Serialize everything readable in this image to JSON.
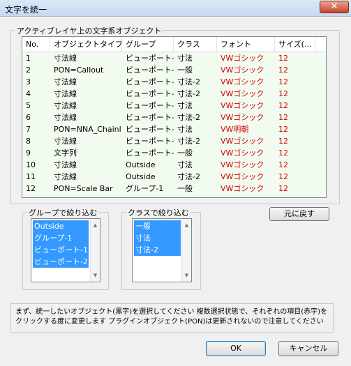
{
  "window": {
    "title": "文字を統一",
    "close_symbol": "✕"
  },
  "objects_group": {
    "legend": "アクティブレイヤ上の文字系オブジェクト",
    "columns": [
      "No.",
      "オブジェクトタイプ",
      "グループ",
      "クラス",
      "フォント",
      "サイズ(..."
    ],
    "rows": [
      [
        "1",
        "寸法線",
        "ビューポート-2",
        "寸法",
        "VWゴシック",
        "12"
      ],
      [
        "2",
        "PON=Callout",
        "ビューポート-1",
        "一般",
        "VWゴシック",
        "12"
      ],
      [
        "3",
        "寸法線",
        "ビューポート-1",
        "寸法-2",
        "VWゴシック",
        "12"
      ],
      [
        "4",
        "寸法線",
        "ビューポート-1",
        "寸法-2",
        "VWゴシック",
        "12"
      ],
      [
        "5",
        "寸法線",
        "ビューポート-1",
        "寸法",
        "VWゴシック",
        "12"
      ],
      [
        "6",
        "寸法線",
        "ビューポート-1",
        "寸法-2",
        "VWゴシック",
        "12"
      ],
      [
        "7",
        "PON=NNA_Chainl",
        "ビューポート-1",
        "寸法",
        "VW明朝",
        "12"
      ],
      [
        "8",
        "寸法線",
        "ビューポート-1",
        "寸法-2",
        "VWゴシック",
        "12"
      ],
      [
        "9",
        "文字列",
        "ビューポート-1",
        "一般",
        "VWゴシック",
        "12"
      ],
      [
        "10",
        "寸法線",
        "Outside",
        "寸法",
        "VWゴシック",
        "12"
      ],
      [
        "11",
        "寸法線",
        "Outside",
        "寸法-2",
        "VWゴシック",
        "12"
      ],
      [
        "12",
        "PON=Scale Bar",
        "グループ-1",
        "一般",
        "VWゴシック",
        "12"
      ]
    ]
  },
  "group_filter": {
    "legend": "グループで絞り込む",
    "items": [
      "Outside",
      "グループ-1",
      "ビューポート-1",
      "ビューポート-2"
    ]
  },
  "class_filter": {
    "legend": "クラスで絞り込む",
    "items": [
      "一般",
      "寸法",
      "寸法-2"
    ]
  },
  "buttons": {
    "reset": "元に戻す",
    "ok": "OK",
    "cancel": "キャンセル"
  },
  "message": "まず、統一したいオブジェクト(黒字)を選択してください 複数選択状態で、それぞれの項目(赤字)をクリックする度に変更します プラグインオブジェクト(PON)は更新されないので注意してください",
  "scroll_arrows": {
    "up": "▲",
    "down": "▼"
  },
  "colors": {
    "selection": "#3399ff",
    "editable_text": "#d40000",
    "table_background": "#f2fbef"
  }
}
